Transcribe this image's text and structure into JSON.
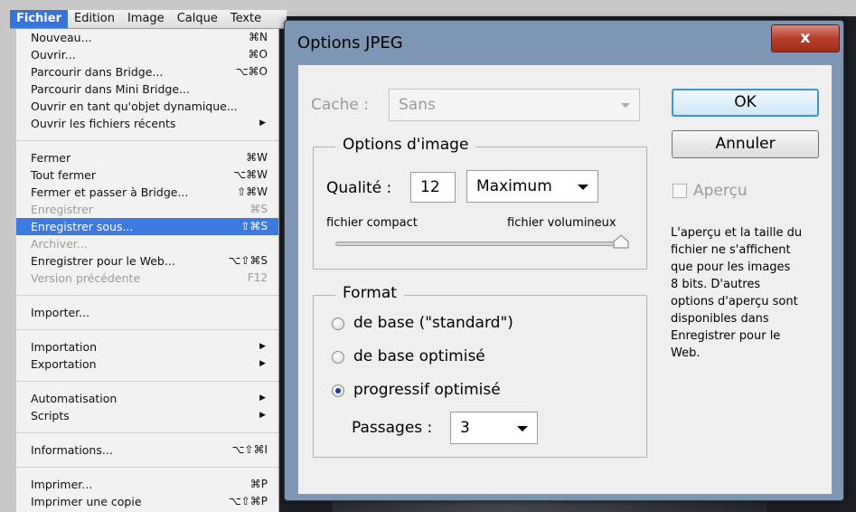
{
  "menubar": {
    "items": [
      "Fichier",
      "Edition",
      "Image",
      "Calque",
      "Texte"
    ]
  },
  "file_menu": {
    "groups": [
      [
        {
          "label": "Nouveau...",
          "shortcut": "⌘N"
        },
        {
          "label": "Ouvrir...",
          "shortcut": "⌘O"
        },
        {
          "label": "Parcourir dans Bridge...",
          "shortcut": "⌥⌘O"
        },
        {
          "label": "Parcourir dans Mini Bridge...",
          "shortcut": ""
        },
        {
          "label": "Ouvrir en tant qu'objet dynamique...",
          "shortcut": ""
        },
        {
          "label": "Ouvrir les fichiers récents",
          "shortcut": "",
          "submenu": true
        }
      ],
      [
        {
          "label": "Fermer",
          "shortcut": "⌘W"
        },
        {
          "label": "Tout fermer",
          "shortcut": "⌥⌘W"
        },
        {
          "label": "Fermer et passer à Bridge...",
          "shortcut": "⇧⌘W"
        },
        {
          "label": "Enregistrer",
          "shortcut": "⌘S",
          "disabled": true
        },
        {
          "label": "Enregistrer sous...",
          "shortcut": "⇧⌘S",
          "selected": true
        },
        {
          "label": "Archiver...",
          "shortcut": "",
          "disabled": true
        },
        {
          "label": "Enregistrer pour le Web...",
          "shortcut": "⌥⇧⌘S"
        },
        {
          "label": "Version précédente",
          "shortcut": "F12",
          "disabled": true
        }
      ],
      [
        {
          "label": "Importer...",
          "shortcut": ""
        }
      ],
      [
        {
          "label": "Importation",
          "shortcut": "",
          "submenu": true
        },
        {
          "label": "Exportation",
          "shortcut": "",
          "submenu": true
        }
      ],
      [
        {
          "label": "Automatisation",
          "shortcut": "",
          "submenu": true
        },
        {
          "label": "Scripts",
          "shortcut": "",
          "submenu": true
        }
      ],
      [
        {
          "label": "Informations...",
          "shortcut": "⌥⇧⌘I"
        }
      ],
      [
        {
          "label": "Imprimer...",
          "shortcut": "⌘P"
        },
        {
          "label": "Imprimer une copie",
          "shortcut": "⌥⇧⌘P"
        }
      ]
    ]
  },
  "dialog": {
    "title": "Options JPEG",
    "close_label": "x",
    "cache": {
      "label": "Cache :",
      "value": "Sans"
    },
    "image_options": {
      "legend": "Options d'image",
      "quality_label": "Qualité :",
      "quality_value": "12",
      "quality_preset": "Maximum",
      "slider_min_label": "fichier compact",
      "slider_max_label": "fichier volumineux",
      "slider_fraction": 1.0
    },
    "format": {
      "legend": "Format",
      "options": [
        "de base  (\"standard\")",
        "de base optimisé",
        "progressif optimisé"
      ],
      "selected_index": 2,
      "passes_label": "Passages :",
      "passes_value": "3"
    },
    "ok_label": "OK",
    "cancel_label": "Annuler",
    "preview_label": "Aperçu",
    "info_text": "L'aperçu et la taille du\nfichier ne s'affichent\nque pour les images\n8 bits. D'autres\noptions d'aperçu sont\ndisponibles dans\nEnregistrer pour le\nWeb."
  },
  "colors": {
    "menu_highlight": "#3d7ae0",
    "dialog_frame": "#7e96b4",
    "close_button": "#b63f2a",
    "ok_border": "#3d95d6"
  }
}
